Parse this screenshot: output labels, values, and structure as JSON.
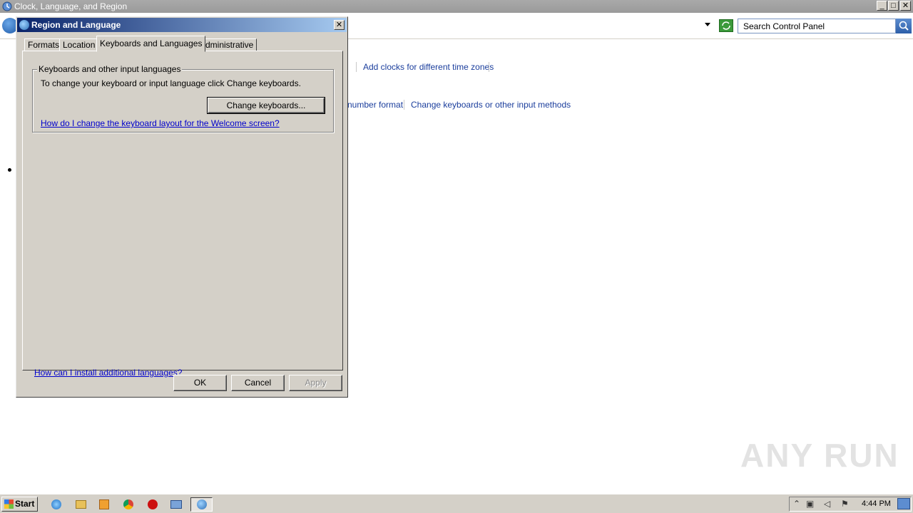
{
  "window": {
    "title": "Clock, Language, and Region",
    "minimize": "_",
    "maximize": "□",
    "close": "✕"
  },
  "address_bar": {
    "search_placeholder": "Search Control Panel"
  },
  "control_panel_links": {
    "add_clocks": "Add clocks for different time zones",
    "number_format": "number format",
    "change_keyboards": "Change keyboards or other input methods"
  },
  "dialog": {
    "title": "Region and Language",
    "close": "✕",
    "tabs": [
      {
        "label": "Formats",
        "active": false
      },
      {
        "label": "Location",
        "active": false
      },
      {
        "label": "Keyboards and Languages",
        "active": true
      },
      {
        "label": "Administrative",
        "active": false
      }
    ],
    "group": {
      "legend": "Keyboards and other input languages",
      "description": "To change your keyboard or input language click Change keyboards.",
      "change_button": "Change keyboards...",
      "welcome_link": "How do I change the keyboard layout for the Welcome screen?"
    },
    "install_link": "How can I install additional languages?",
    "buttons": {
      "ok": "OK",
      "cancel": "Cancel",
      "apply": "Apply"
    }
  },
  "taskbar": {
    "start_label": "Start",
    "icons": [
      "internet-explorer-icon",
      "explorer-folder-icon",
      "media-player-icon",
      "chrome-icon",
      "opera-icon",
      "control-panel-icon",
      "region-language-icon"
    ],
    "clock": "4:44 PM"
  },
  "watermark": "ANY RUN",
  "colors": {
    "dialog_title_start": "#0a246a",
    "dialog_title_end": "#a6caf0",
    "link": "#0000cc",
    "face": "#d4d0c8"
  }
}
